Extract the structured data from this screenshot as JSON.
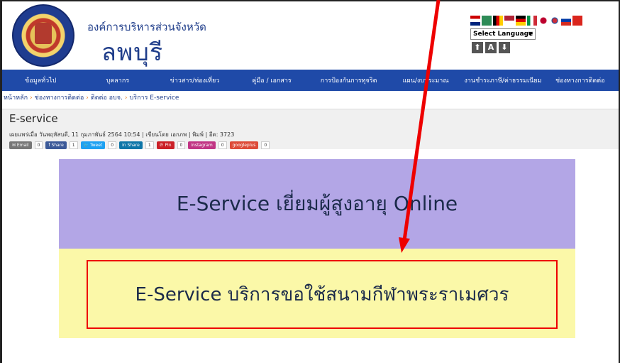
{
  "header": {
    "org_name": "องค์การบริหารส่วนจังหวัด",
    "province": "ลพบุรี",
    "language_select": "Select Language",
    "font_buttons": [
      "⬆",
      "A",
      "⬇"
    ]
  },
  "nav": {
    "items": [
      "ข้อมูลทั่วไป",
      "บุคลากร",
      "ข่าวสาร/ท่องเที่ยว",
      "คู่มือ / เอกสาร",
      "การป้องกันการทุจริต",
      "แผน/งบประมาณ",
      "งานชำระภาษี/ค่าธรรมเนียม",
      "ช่องทางการติดต่อ"
    ]
  },
  "breadcrumb": {
    "items": [
      "หน้าหลัก",
      "ช่องทางการติดต่อ",
      "ติดต่อ อบจ.",
      "บริการ E-service"
    ],
    "separator": "›"
  },
  "article": {
    "title": "E-service",
    "meta": "เผยแพร่เมื่อ วันพฤหัสบดี, 11 กุมภาพันธ์ 2564 10:54 | เขียนโดย เอกภพ | พิมพ์ | อีด: 3723"
  },
  "share": [
    {
      "label": "✉ Email",
      "count": "0",
      "color": "#777777"
    },
    {
      "label": "f Share",
      "count": "1",
      "color": "#3b5998"
    },
    {
      "label": "🐦 Tweet",
      "count": "0",
      "color": "#1da1f2"
    },
    {
      "label": "in Share",
      "count": "1",
      "color": "#0e76a8"
    },
    {
      "label": "℗ Pin",
      "count": "0",
      "color": "#cb2027"
    },
    {
      "label": "instagram",
      "count": "0",
      "color": "#c13584"
    },
    {
      "label": "googleplus",
      "count": "0",
      "color": "#dd4b39"
    }
  ],
  "banners": {
    "elderly_visit": "E-Service เยี่ยมผู้สูงอายุ Online",
    "stadium_booking": "E-Service บริการขอใช้สนามกีฬาพระราเมศวร"
  },
  "colors": {
    "nav_bg": "#1f4aa8",
    "banner_purple": "#b3a6e6",
    "banner_yellow": "#fbf8a8",
    "annotation_red": "#ee0000"
  }
}
